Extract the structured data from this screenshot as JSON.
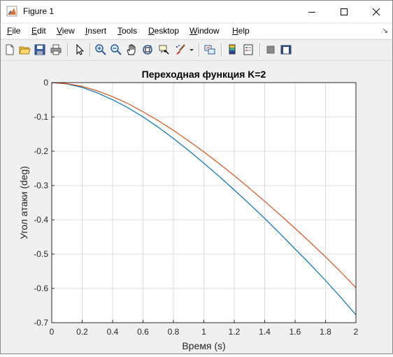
{
  "window": {
    "title": "Figure 1"
  },
  "menu": {
    "items": [
      {
        "key": "F",
        "rest": "ile"
      },
      {
        "key": "E",
        "rest": "dit"
      },
      {
        "key": "V",
        "rest": "iew"
      },
      {
        "key": "I",
        "rest": "nsert"
      },
      {
        "key": "T",
        "rest": "ools"
      },
      {
        "key": "D",
        "rest": "esktop"
      },
      {
        "key": "W",
        "rest": "indow"
      },
      {
        "key": "H",
        "rest": "elp"
      }
    ]
  },
  "toolbar": {
    "icons": [
      "new-figure-icon",
      "open-file-icon",
      "save-icon",
      "print-icon",
      "edit-plot-arrow-icon",
      "zoom-in-icon",
      "zoom-out-icon",
      "pan-hand-icon",
      "rotate-3d-icon",
      "data-cursor-icon",
      "brush-icon",
      "brush-dropdown-icon",
      "link-plot-icon",
      "insert-colorbar-icon",
      "insert-legend-icon",
      "hide-plot-tools-icon",
      "show-plot-tools-icon"
    ]
  },
  "colors": {
    "series1": "#0072bd",
    "series2": "#d95319"
  },
  "chart_data": {
    "type": "line",
    "title": "Переходная функция K=2",
    "xlabel": "Время (s)",
    "ylabel": "Угол атаки (deg)",
    "xlim": [
      0,
      2
    ],
    "ylim": [
      -0.7,
      0
    ],
    "grid": true,
    "xticks": [
      "0",
      "0.2",
      "0.4",
      "0.6",
      "0.8",
      "1",
      "1.2",
      "1.4",
      "1.6",
      "1.8",
      "2"
    ],
    "yticks": [
      "0",
      "-0.1",
      "-0.2",
      "-0.3",
      "-0.4",
      "-0.5",
      "-0.6",
      "-0.7"
    ],
    "x": [
      0,
      0.1,
      0.2,
      0.3,
      0.4,
      0.5,
      0.6,
      0.7,
      0.8,
      0.9,
      1.0,
      1.1,
      1.2,
      1.3,
      1.4,
      1.5,
      1.6,
      1.7,
      1.8,
      1.9,
      2.0
    ],
    "series": [
      {
        "values": [
          0,
          -0.004,
          -0.014,
          -0.03,
          -0.05,
          -0.073,
          -0.1,
          -0.13,
          -0.163,
          -0.198,
          -0.235,
          -0.273,
          -0.313,
          -0.354,
          -0.396,
          -0.44,
          -0.485,
          -0.53,
          -0.577,
          -0.626,
          -0.677
        ]
      },
      {
        "values": [
          0,
          -0.003,
          -0.011,
          -0.024,
          -0.041,
          -0.061,
          -0.085,
          -0.111,
          -0.139,
          -0.17,
          -0.202,
          -0.236,
          -0.271,
          -0.308,
          -0.346,
          -0.385,
          -0.425,
          -0.466,
          -0.508,
          -0.552,
          -0.598
        ]
      }
    ]
  }
}
